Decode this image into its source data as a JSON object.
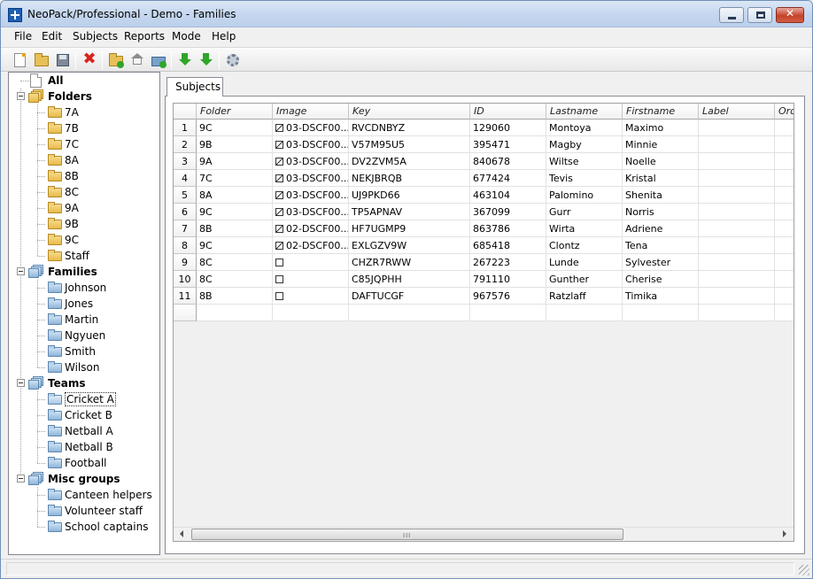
{
  "window": {
    "title": "NeoPack/Professional - Demo - Families"
  },
  "menu": [
    "File",
    "Edit",
    "Subjects",
    "Reports",
    "Mode",
    "Help"
  ],
  "toolbar": {
    "buttons": [
      {
        "icon": "new-document-icon"
      },
      {
        "icon": "open-folder-icon"
      },
      {
        "icon": "save-icon"
      },
      {
        "icon": "delete-icon"
      },
      {
        "icon": "new-folder-icon"
      },
      {
        "icon": "home-icon"
      },
      {
        "icon": "tray-add-icon"
      },
      {
        "icon": "import-down-icon"
      },
      {
        "icon": "export-down-icon"
      },
      {
        "icon": "settings-gear-icon"
      }
    ]
  },
  "tree": {
    "all": "All",
    "folders": {
      "label": "Folders",
      "items": [
        "7A",
        "7B",
        "7C",
        "8A",
        "8B",
        "8C",
        "9A",
        "9B",
        "9C",
        "Staff"
      ]
    },
    "families": {
      "label": "Families",
      "items": [
        "Johnson",
        "Jones",
        "Martin",
        "Ngyuen",
        "Smith",
        "Wilson"
      ]
    },
    "teams": {
      "label": "Teams",
      "items": [
        "Cricket A",
        "Cricket B",
        "Netball A",
        "Netball B",
        "Football"
      ],
      "selected": "Cricket A"
    },
    "misc": {
      "label": "Misc groups",
      "items": [
        "Canteen helpers",
        "Volunteer staff",
        "School captains"
      ]
    }
  },
  "tab": {
    "label": "Subjects"
  },
  "grid": {
    "columns": [
      "Folder",
      "Image",
      "Key",
      "ID",
      "Lastname",
      "Firstname",
      "Label",
      "Ord"
    ],
    "rows": [
      {
        "n": "1",
        "folder": "9C",
        "image": "03-DSCF00...",
        "has_image": true,
        "key": "RVCDNBYZ",
        "id": "129060",
        "lastname": "Montoya",
        "firstname": "Maximo"
      },
      {
        "n": "2",
        "folder": "9B",
        "image": "03-DSCF00...",
        "has_image": true,
        "key": "V57M95U5",
        "id": "395471",
        "lastname": "Magby",
        "firstname": "Minnie"
      },
      {
        "n": "3",
        "folder": "9A",
        "image": "03-DSCF00...",
        "has_image": true,
        "key": "DV2ZVM5A",
        "id": "840678",
        "lastname": "Wiltse",
        "firstname": "Noelle"
      },
      {
        "n": "4",
        "folder": "7C",
        "image": "03-DSCF00...",
        "has_image": true,
        "key": "NEKJBRQB",
        "id": "677424",
        "lastname": "Tevis",
        "firstname": "Kristal"
      },
      {
        "n": "5",
        "folder": "8A",
        "image": "03-DSCF00...",
        "has_image": true,
        "key": "UJ9PKD66",
        "id": "463104",
        "lastname": "Palomino",
        "firstname": "Shenita"
      },
      {
        "n": "6",
        "folder": "9C",
        "image": "03-DSCF00...",
        "has_image": true,
        "key": "TP5APNAV",
        "id": "367099",
        "lastname": "Gurr",
        "firstname": "Norris"
      },
      {
        "n": "7",
        "folder": "8B",
        "image": "02-DSCF00...",
        "has_image": true,
        "key": "HF7UGMP9",
        "id": "863786",
        "lastname": "Wirta",
        "firstname": "Adriene"
      },
      {
        "n": "8",
        "folder": "9C",
        "image": "02-DSCF00...",
        "has_image": true,
        "key": "EXLGZV9W",
        "id": "685418",
        "lastname": "Clontz",
        "firstname": "Tena"
      },
      {
        "n": "9",
        "folder": "8C",
        "image": "",
        "has_image": false,
        "key": "CHZR7RWW",
        "id": "267223",
        "lastname": "Lunde",
        "firstname": "Sylvester"
      },
      {
        "n": "10",
        "folder": "8C",
        "image": "",
        "has_image": false,
        "key": "C85JQPHH",
        "id": "791110",
        "lastname": "Gunther",
        "firstname": "Cherise"
      },
      {
        "n": "11",
        "folder": "8B",
        "image": "",
        "has_image": false,
        "key": "DAFTUCGF",
        "id": "967576",
        "lastname": "Ratzlaff",
        "firstname": "Timika"
      }
    ]
  },
  "scrollbar": {
    "grip": "III"
  }
}
